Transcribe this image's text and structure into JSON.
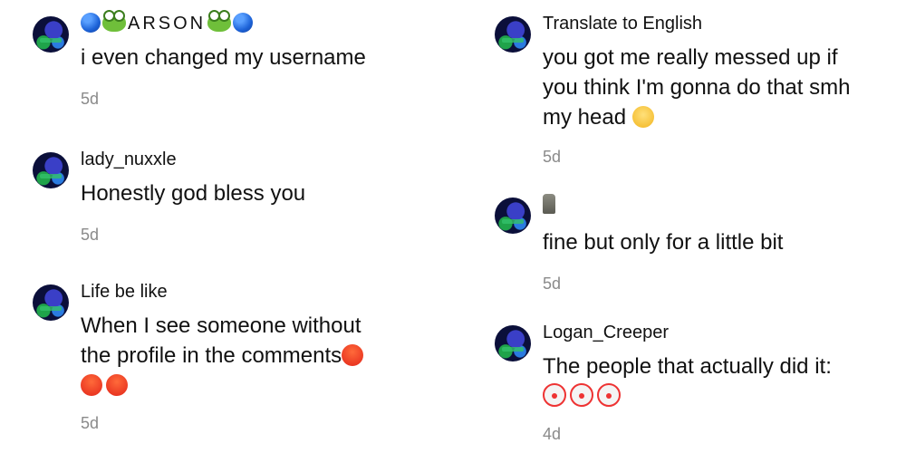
{
  "left_column": [
    {
      "username": "ARSON",
      "text": "i even changed my username",
      "time": "5d",
      "icons": [
        "blue-circle-icon",
        "frog-icon",
        "frog-icon",
        "blue-circle-icon"
      ]
    },
    {
      "username": "lady_nuxxle",
      "text": "Honestly god bless you",
      "time": "5d"
    },
    {
      "username": "Life be like",
      "text_line1": "When I see someone without",
      "text_line2": "the profile in the comments",
      "time": "5d",
      "icons": [
        "angry-face-icon",
        "angry-face-icon",
        "angry-face-icon"
      ]
    }
  ],
  "right_column": [
    {
      "username": "Translate to English",
      "text_line1": "you got me really messed up if",
      "text_line2": "you think I'm gonna do that smh",
      "text_line3": "my head",
      "time": "5d",
      "icons": [
        "eye-roll-face-icon"
      ]
    },
    {
      "username": "",
      "text": "fine but only for a little bit",
      "time": "5d",
      "icons": [
        "moai-icon"
      ]
    },
    {
      "username": "Logan_Creeper",
      "text": "The people that actually did it:",
      "time": "4d",
      "icons": [
        "clown-face-icon",
        "clown-face-icon",
        "clown-face-icon"
      ]
    }
  ],
  "colors": {
    "text": "#111111",
    "timestamp": "#8a8a8a",
    "background": "#ffffff"
  }
}
